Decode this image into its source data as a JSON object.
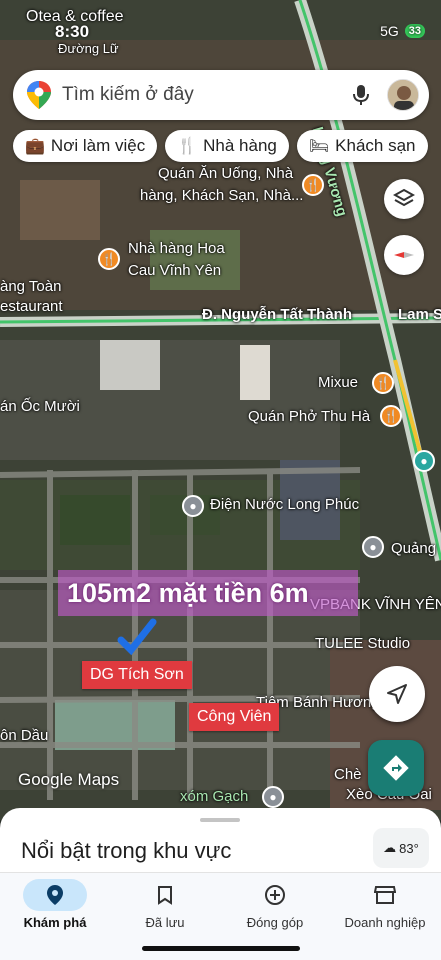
{
  "status": {
    "time": "8:30",
    "network": "5G",
    "battery": "33",
    "overlay_app": "Otea & coffee",
    "overlay_street": "Đường Lữ"
  },
  "search": {
    "placeholder": "Tìm kiếm ở đây"
  },
  "chips": [
    {
      "icon": "briefcase-icon",
      "label": "Nơi làm việc"
    },
    {
      "icon": "fork-knife-icon",
      "label": "Nhà hàng"
    },
    {
      "icon": "bed-icon",
      "label": "Khách sạn"
    }
  ],
  "map": {
    "labels": {
      "quan_an": "Quán Ăn Uống, Nhà",
      "quan_an2": "hàng, Khách Sạn, Nhà...",
      "nha_hang_hoa": "Nhà hàng Hoa",
      "cau_vinh_yen": "Cau Vĩnh Yên",
      "lang_toan": "àng Toàn",
      "restaurant": "estaurant",
      "nguyen_tat_thanh": "Đ. Nguyễn Tất Thành",
      "lam_s": "Lam S",
      "hung_vuong": "Hùng Vương",
      "mixue": "Mixue",
      "quan_pho": "Quán Phở Thu Hà",
      "quan_oc": "án Ốc Mười",
      "dien_nuoc": "Điện Nước Long Phúc",
      "quang": "Quảng",
      "vpbank": "VPBANK VĨNH YÊN",
      "tulee": "TULEE Studio",
      "banh_huong": "Tiệm Bánh Hương",
      "on_dau": "ôn Dầu",
      "che": "Chè",
      "xeo": "Xèo Cầu Oai",
      "xom_gach": "xóm Gạch",
      "google_maps": "Google Maps"
    },
    "banner": "105m2 mặt tiền 6m",
    "tag_tich_son": "DG Tích Sơn",
    "tag_cong_vien": "Công Viên"
  },
  "sheet": {
    "title": "Nổi bật trong khu vực",
    "temperature": "83°"
  },
  "nav": [
    {
      "label": "Khám phá",
      "active": true
    },
    {
      "label": "Đã lưu",
      "active": false
    },
    {
      "label": "Đóng góp",
      "active": false
    },
    {
      "label": "Doanh nghiệp",
      "active": false
    }
  ]
}
